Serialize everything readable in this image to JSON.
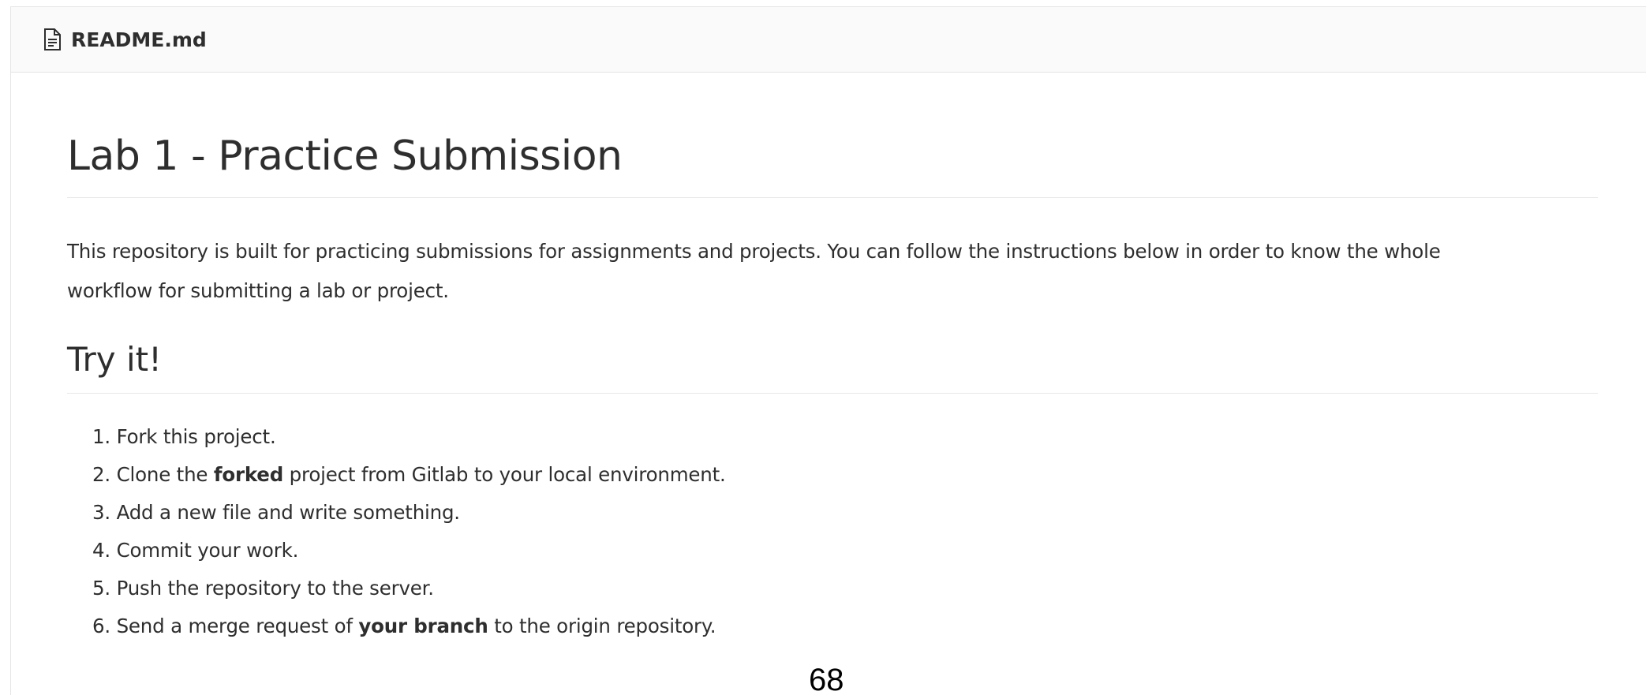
{
  "file_header": {
    "icon": "file-text-icon",
    "file_name": "README.md"
  },
  "readme": {
    "title": "Lab 1 - Practice Submission",
    "intro_line1": "This repository is built for practicing submissions for assignments and projects. You can follow the instructions below in order to know the whole",
    "intro_line2": "workflow for submitting a lab or project.",
    "section_heading": "Try it!",
    "steps": [
      {
        "number": "1.",
        "before": "Fork this project.",
        "bold": "",
        "after": ""
      },
      {
        "number": "2.",
        "before": "Clone the ",
        "bold": "forked",
        "after": " project from Gitlab to your local environment."
      },
      {
        "number": "3.",
        "before": "Add a new file and write something.",
        "bold": "",
        "after": ""
      },
      {
        "number": "4.",
        "before": "Commit your work.",
        "bold": "",
        "after": ""
      },
      {
        "number": "5.",
        "before": "Push the repository to the server.",
        "bold": "",
        "after": ""
      },
      {
        "number": "6.",
        "before": "Send a merge request of ",
        "bold": "your branch",
        "after": " to the origin repository."
      }
    ]
  },
  "page_number": "68",
  "colors": {
    "text": "#2e2e2e",
    "header_background": "#fafafa",
    "border": "#e5e5e5"
  }
}
